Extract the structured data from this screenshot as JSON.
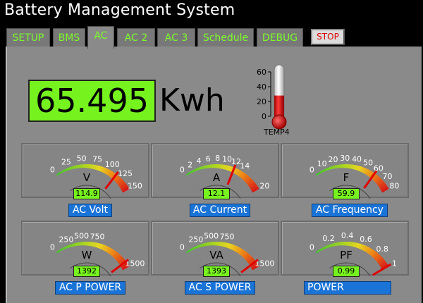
{
  "app": {
    "title": "Battery Management System"
  },
  "tabs": [
    {
      "label": "SETUP",
      "active": false
    },
    {
      "label": "BMS",
      "active": false
    },
    {
      "label": "AC",
      "active": true
    },
    {
      "label": "AC  2",
      "active": false
    },
    {
      "label": "AC  3",
      "active": false
    },
    {
      "label": "Schedule",
      "active": false
    },
    {
      "label": "DEBUG",
      "active": false
    }
  ],
  "stop_button": {
    "label": "STOP"
  },
  "energy": {
    "value": "65.495",
    "unit": "Kwh"
  },
  "thermometer": {
    "label": "TEMP4",
    "ticks": [
      "60",
      "40",
      "20",
      "0"
    ],
    "value": 28,
    "min": 0,
    "max": 60
  },
  "gauges": [
    {
      "unit": "V",
      "label": "AC Volt",
      "readout": "114.9",
      "min": 0,
      "max": 150,
      "value": 114.9,
      "ticks": [
        0,
        25,
        50,
        75,
        100,
        125,
        150
      ]
    },
    {
      "unit": "A",
      "label": "AC Current",
      "readout": "12.1",
      "min": 0,
      "max": 20,
      "value": 12.1,
      "ticks": [
        0,
        2,
        4,
        6,
        8,
        10,
        12,
        14,
        20
      ]
    },
    {
      "unit": "F",
      "label": "AC Frequency",
      "readout": "59.9",
      "min": 0,
      "max": 80,
      "value": 59.9,
      "ticks": [
        0,
        10,
        20,
        30,
        40,
        50,
        60,
        70,
        80
      ]
    },
    {
      "unit": "W",
      "label": "AC P POWER",
      "readout": "1392",
      "min": 0,
      "max": 1500,
      "value": 1392,
      "ticks": [
        0,
        250,
        500,
        750,
        1500
      ]
    },
    {
      "unit": "VA",
      "label": "AC S POWER",
      "readout": "1393",
      "min": 0,
      "max": 1500,
      "value": 1393,
      "ticks": [
        0,
        250,
        500,
        750,
        1500
      ]
    },
    {
      "unit": "PF",
      "label": "POWER",
      "readout": "0.99",
      "min": 0,
      "max": 1,
      "value": 0.99,
      "ticks": [
        "0",
        "0.2",
        "0.4",
        "0.6",
        "0.8",
        "1"
      ]
    }
  ],
  "colors": {
    "accent_green": "#76f21e",
    "tab_text": "#7cfc2a",
    "label_blue": "#1a73d6",
    "needle_red": "#e00000",
    "panel_gray": "#8a8a8a"
  }
}
